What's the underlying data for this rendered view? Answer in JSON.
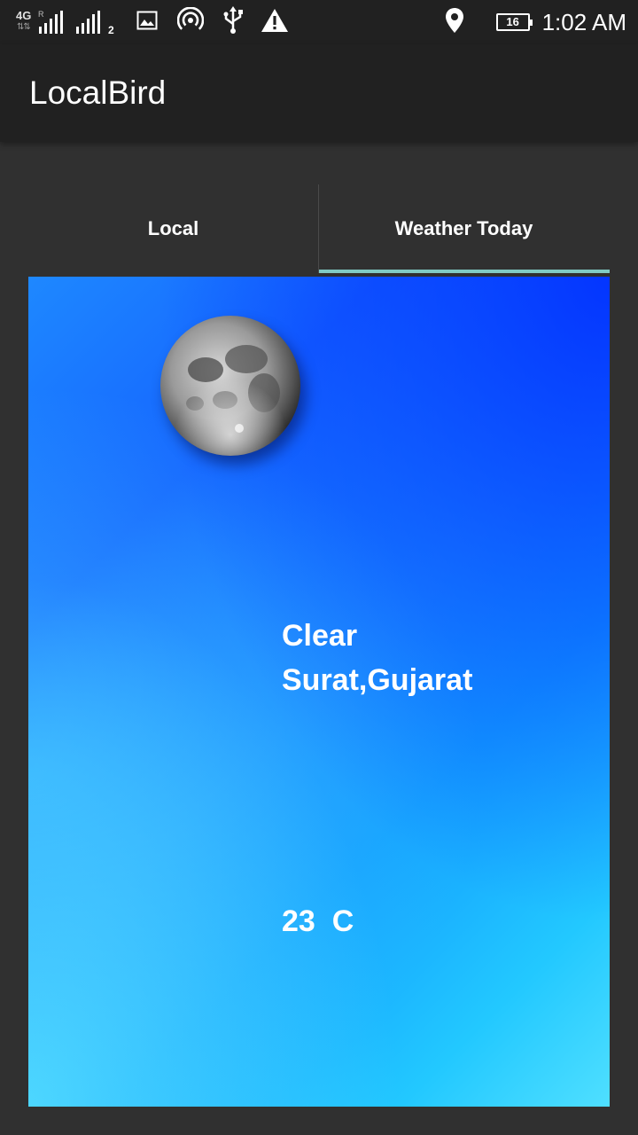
{
  "status_bar": {
    "network": "4G",
    "roaming": "R",
    "sim_slot": "2",
    "battery_level": "16",
    "time": "1:02 AM"
  },
  "app": {
    "title": "LocalBird"
  },
  "tabs": [
    {
      "label": "Local",
      "selected": false
    },
    {
      "label": "Weather Today",
      "selected": true
    }
  ],
  "weather": {
    "icon": "moon-icon",
    "condition": "Clear",
    "location": "Surat,Gujarat",
    "temperature": "23  C"
  },
  "colors": {
    "app_bar": "#212121",
    "background": "#303030",
    "tab_indicator": "#80cbc4"
  }
}
